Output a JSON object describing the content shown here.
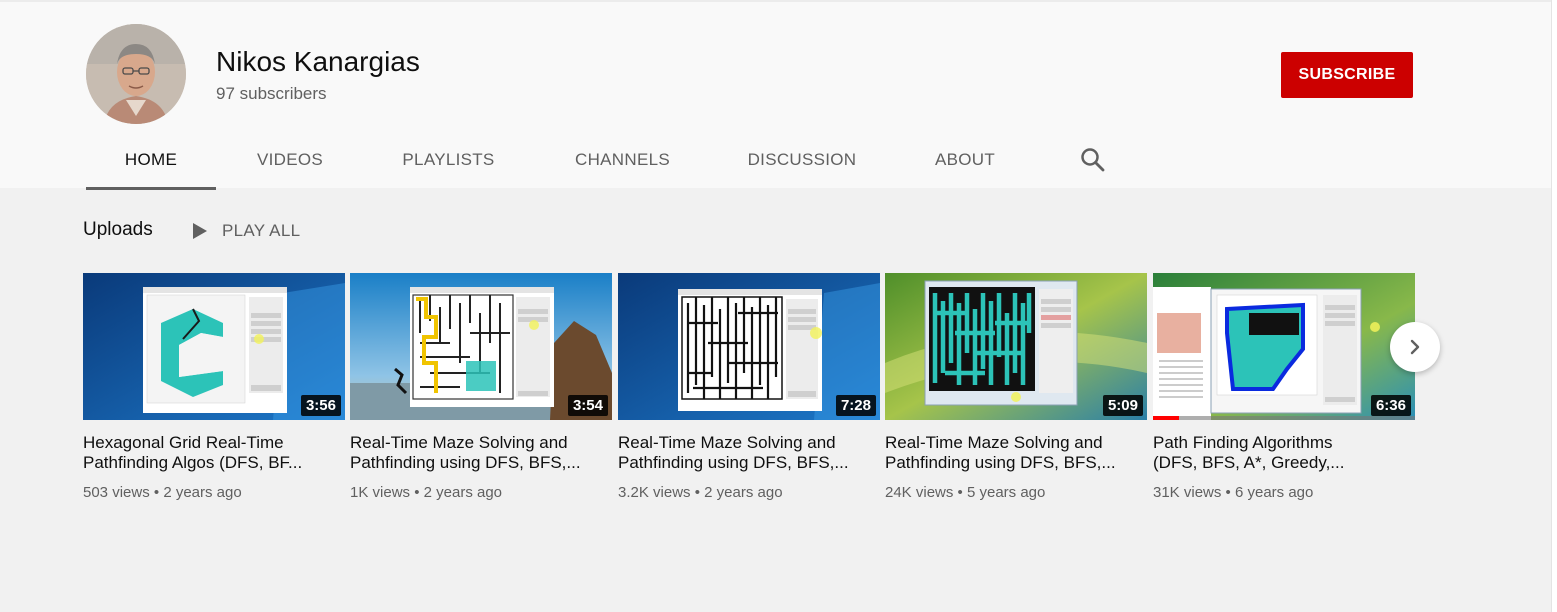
{
  "channel": {
    "name": "Nikos Kanargias",
    "subscribers": "97 subscribers",
    "subscribe_label": "SUBSCRIBE",
    "accent_color": "#cc0000"
  },
  "tabs": [
    {
      "label": "HOME",
      "active": true
    },
    {
      "label": "VIDEOS"
    },
    {
      "label": "PLAYLISTS"
    },
    {
      "label": "CHANNELS"
    },
    {
      "label": "DISCUSSION"
    },
    {
      "label": "ABOUT"
    }
  ],
  "search_icon": "search-icon",
  "uploads": {
    "title": "Uploads",
    "play_all_label": "PLAY ALL"
  },
  "videos": [
    {
      "title": "Hexagonal Grid Real-Time\nPathfinding Algos (DFS, BF...",
      "views": "503 views",
      "age": "2 years ago",
      "duration": "3:56"
    },
    {
      "title": "Real-Time Maze Solving and\nPathfinding using DFS, BFS,...",
      "views": "1K views",
      "age": "2 years ago",
      "duration": "3:54"
    },
    {
      "title": "Real-Time Maze Solving and\nPathfinding using DFS, BFS,...",
      "views": "3.2K views",
      "age": "2 years ago",
      "duration": "7:28"
    },
    {
      "title": "Real-Time Maze Solving and\nPathfinding using DFS, BFS,...",
      "views": "24K views",
      "age": "5 years ago",
      "duration": "5:09"
    },
    {
      "title": "Path Finding Algorithms\n(DFS, BFS, A*, Greedy,...",
      "views": "31K views",
      "age": "6 years ago",
      "duration": "6:36",
      "watched_fraction": 0.1
    }
  ],
  "meta_separator": "•",
  "next_icon": "chevron-right-icon"
}
